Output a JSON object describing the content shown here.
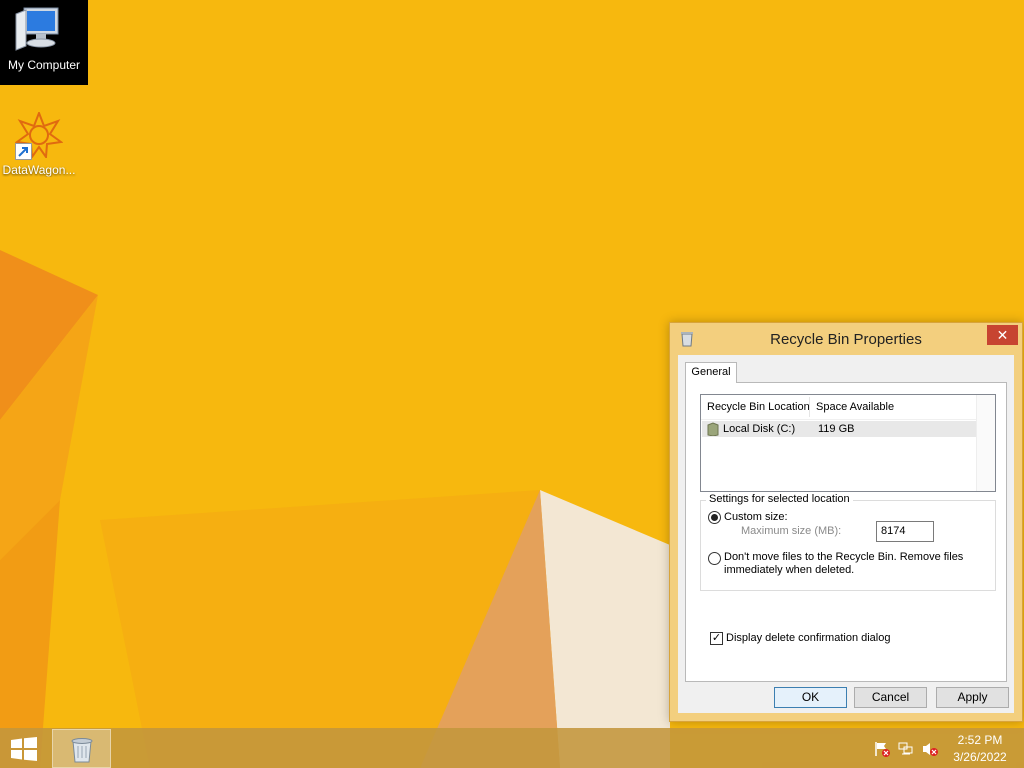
{
  "desktop": {
    "icons": [
      {
        "label": "My Computer",
        "icon": "my-computer-icon"
      },
      {
        "label": "DataWagon...",
        "icon": "datawagon-icon"
      }
    ]
  },
  "dialog": {
    "title": "Recycle Bin Properties",
    "close_label": "✕",
    "tab": "General",
    "list": {
      "headers": [
        "Recycle Bin Location",
        "Space Available"
      ],
      "rows": [
        {
          "location": "Local Disk (C:)",
          "space": "119 GB",
          "icon": "drive-icon"
        }
      ]
    },
    "settings": {
      "legend": "Settings for selected location",
      "custom_size_label": "Custom size:",
      "custom_size_selected": true,
      "max_size_label": "Maximum size (MB):",
      "max_size_value": "8174",
      "no_move_label": "Don't move files to the Recycle Bin. Remove files immediately when deleted.",
      "no_move_selected": false
    },
    "confirm_label": "Display delete confirmation dialog",
    "confirm_checked": true,
    "buttons": {
      "ok": "OK",
      "cancel": "Cancel",
      "apply": "Apply"
    }
  },
  "taskbar": {
    "start_icon": "windows-logo-icon",
    "pinned": [
      {
        "icon": "recycle-bin-icon"
      }
    ],
    "tray": [
      "action-center-flag-icon",
      "network-icon",
      "volume-muted-icon"
    ],
    "time": "2:52 PM",
    "date": "3/26/2022"
  },
  "colors": {
    "wallpaper": "#f6b40c",
    "dialog_frame": "#f3cf7e",
    "close_button": "#c74431",
    "ok_button_border": "#3c7fb1"
  }
}
